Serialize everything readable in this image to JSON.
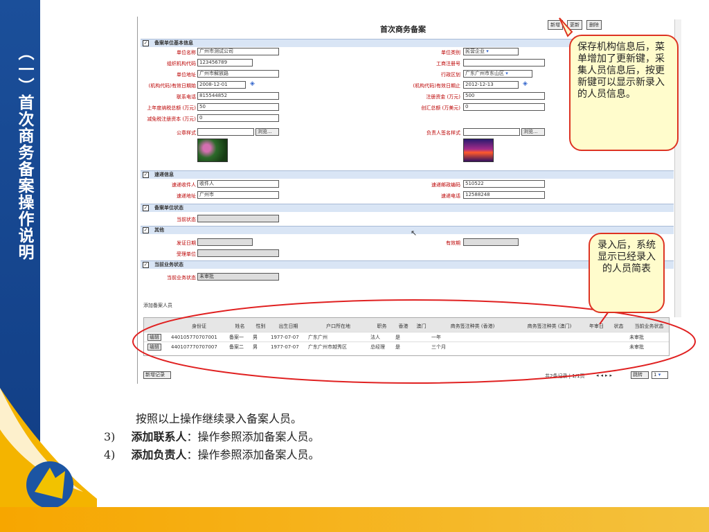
{
  "sidebar": {
    "title": "（一）首次商务备案操作说明"
  },
  "form": {
    "title": "首次商务备案",
    "buttons": [
      "新增",
      "更新",
      "删除"
    ],
    "sections": {
      "basic": "备案单位基本信息",
      "mail": "速递信息",
      "status": "备案单位状态",
      "other": "其他",
      "business": "当前业务状态"
    },
    "fields": {
      "unit_name_label": "单位名称",
      "unit_name": "广州市测试公司",
      "unit_type_label": "单位类别",
      "unit_type": "民营企业",
      "org_code_label": "组织机构代码",
      "org_code": "123456789",
      "reg_no_label": "工商注册号",
      "reg_no": "",
      "address_label": "单位地址",
      "address": "广州市解放路",
      "district_label": "行政区划",
      "district": "广东广州市东山区",
      "valid_start_label": "(机构代码)有效日期始",
      "valid_start": "2008-12-01",
      "valid_end_label": "(机构代码)有效日期止",
      "valid_end": "2012-12-13",
      "phone_label": "联系电话",
      "phone": "815544852",
      "capital_label": "注册资金 (万元)",
      "capital": "500",
      "tax_label": "上年度纳税总额 (万元)",
      "tax": "50",
      "fx_label": "创汇总额 (万美元)",
      "fx": "0",
      "reduce_label": "减免税注册资本 (万元)",
      "reduce": "0",
      "seal_label": "公章样式",
      "browse": "浏览...",
      "sign_label": "负责人签名样式",
      "mail_person_label": "速递收件人",
      "mail_person": "收件人",
      "zip_label": "速递邮政编码",
      "zip": "510522",
      "mail_addr_label": "速递地址",
      "mail_addr": "广州市",
      "mail_phone_label": "速递电话",
      "mail_phone": "12588248",
      "cur_status_label": "当前状态",
      "issue_date_label": "发证日期",
      "expire_label": "有效期",
      "accept_unit_label": "受理单位",
      "biz_status_label": "当前业务状态",
      "biz_status": "未审批"
    },
    "personnel_title": "添加备案人员",
    "grid": {
      "headers": [
        "",
        "身份证",
        "姓名",
        "性别",
        "出生日期",
        "户口所在地",
        "职务",
        "香港",
        "澳门",
        "商务签注种类 (香港)",
        "商务签注种类 (澳门)",
        "年审日",
        "状态",
        "当前业务状态"
      ],
      "rows": [
        [
          "编辑",
          "440105770707001",
          "备案一",
          "男",
          "1977-07-07",
          "广东广州",
          "法人",
          "是",
          "",
          "一年",
          "",
          "",
          "",
          "未审批"
        ],
        [
          "编辑",
          "440107770707007",
          "备案二",
          "男",
          "1977-07-07",
          "广东广州市越秀区",
          "总经理",
          "是",
          "",
          "三个月",
          "",
          "",
          "",
          "未审批"
        ]
      ]
    },
    "add_record": "新增记录",
    "pager": {
      "summary": "共2条记录 | 1/1页",
      "jump": "跳转",
      "page": "1"
    }
  },
  "callouts": {
    "top": "保存机构信息后，菜单增加了更新键，采集人员信息后，按更新键可以显示新录入的人员信息。",
    "bottom": "录入后，系统显示已经录入的人员简表"
  },
  "instructions": {
    "line1": "按照以上操作继续录入备案人员。",
    "item3_num": "3)",
    "item3_bold": "添加联系人",
    "item3_rest": "：操作参照添加备案人员。",
    "item4_num": "4)",
    "item4_bold": "添加负责人",
    "item4_rest": "：操作参照添加备案人员。"
  }
}
